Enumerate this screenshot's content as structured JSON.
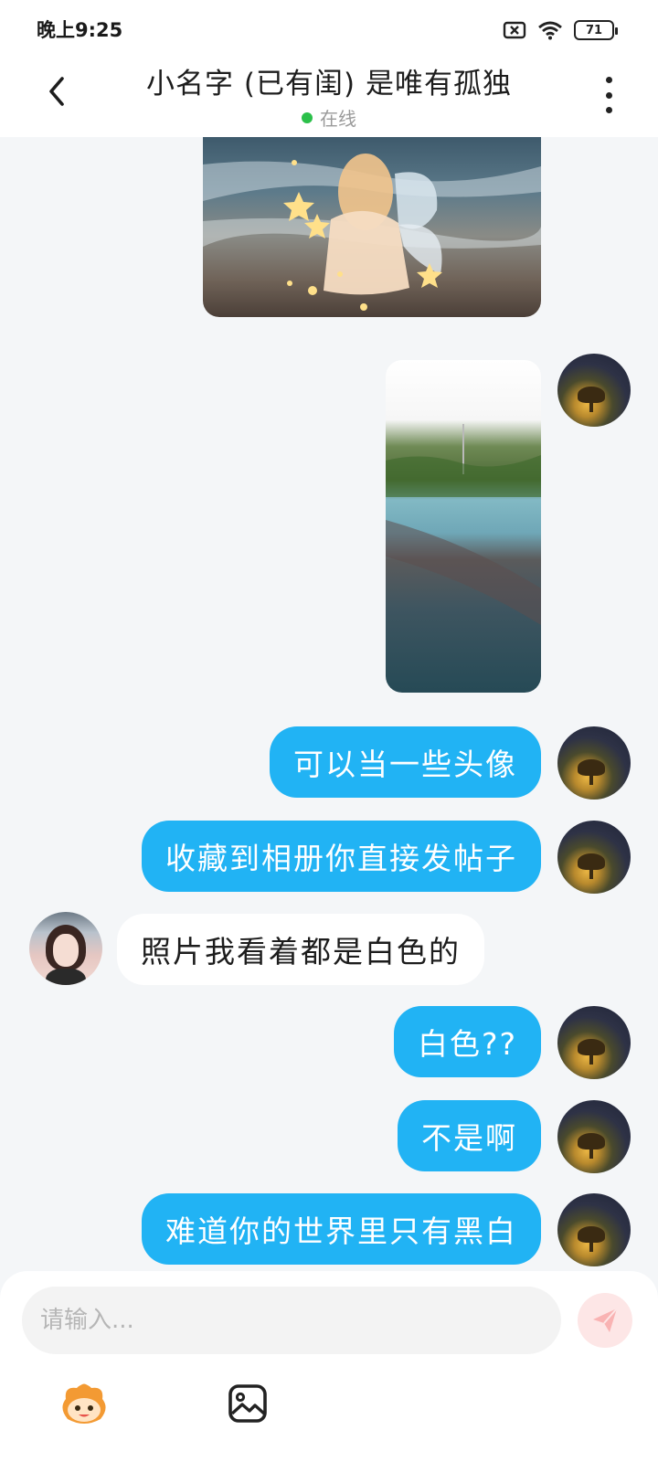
{
  "status_bar": {
    "time": "晚上9:25",
    "battery": "71"
  },
  "header": {
    "title": "小名字 (已有闺) 是唯有孤独",
    "status_text": "在线",
    "status_color": "#2bc04a"
  },
  "colors": {
    "outgoing_bubble": "#21b3f4",
    "incoming_bubble": "#ffffff",
    "background": "#f4f6f8"
  },
  "messages": [
    {
      "from": "other",
      "type": "image",
      "description_icon": "photo"
    },
    {
      "from": "me",
      "type": "image",
      "description_icon": "photo"
    },
    {
      "from": "me",
      "type": "text",
      "text": "可以当一些头像"
    },
    {
      "from": "me",
      "type": "text",
      "text": "收藏到相册你直接发帖子"
    },
    {
      "from": "other",
      "type": "text",
      "text": "照片我看着都是白色的"
    },
    {
      "from": "me",
      "type": "text",
      "text": "白色??"
    },
    {
      "from": "me",
      "type": "text",
      "text": "不是啊"
    },
    {
      "from": "me",
      "type": "text",
      "text": "难道你的世界里只有黑白"
    }
  ],
  "composer": {
    "placeholder": "请输入...",
    "value": ""
  },
  "toolbar": {
    "icons": [
      "emoji-mascot-icon",
      "image-picker-icon"
    ]
  }
}
